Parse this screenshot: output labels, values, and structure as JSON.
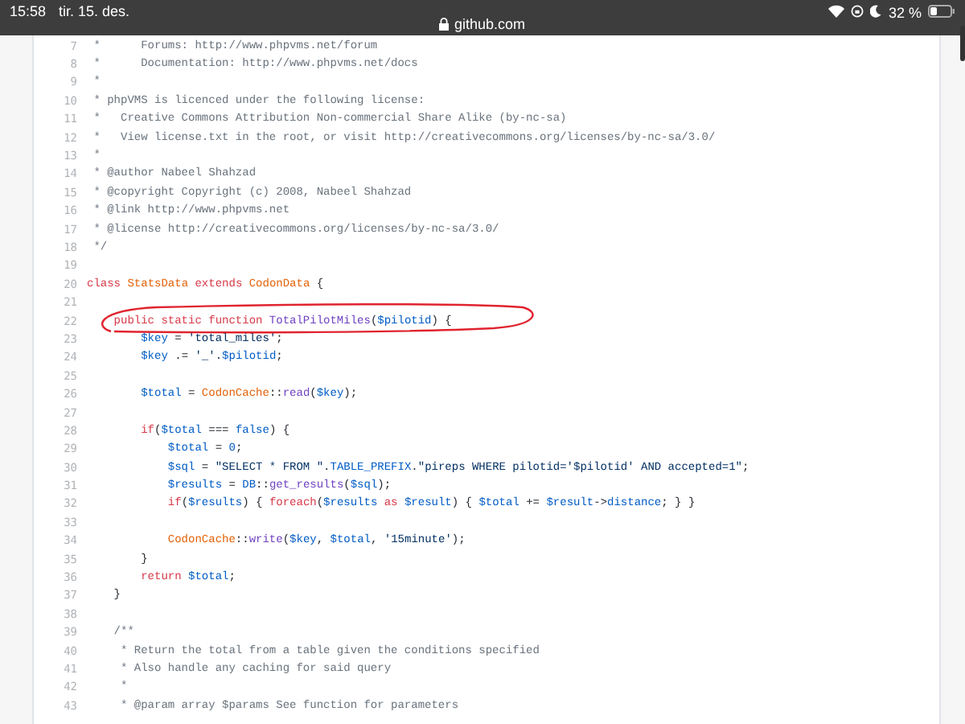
{
  "status_bar": {
    "time": "15:58",
    "date": "tir. 15. des.",
    "battery_percent": "32 %"
  },
  "address_bar": {
    "url": "github.com"
  },
  "code_lines": [
    {
      "number": "7",
      "tokens": [
        {
          "kind": "comment",
          "text": " *      Forums: http://www.phpvms.net/forum"
        }
      ]
    },
    {
      "number": "8",
      "tokens": [
        {
          "kind": "comment",
          "text": " *      Documentation: http://www.phpvms.net/docs"
        }
      ]
    },
    {
      "number": "9",
      "tokens": [
        {
          "kind": "comment",
          "text": " *"
        }
      ]
    },
    {
      "number": "10",
      "tokens": [
        {
          "kind": "comment",
          "text": " * phpVMS is licenced under the following license:"
        }
      ]
    },
    {
      "number": "11",
      "tokens": [
        {
          "kind": "comment",
          "text": " *   Creative Commons Attribution Non-commercial Share Alike (by-nc-sa)"
        }
      ]
    },
    {
      "number": "12",
      "tokens": [
        {
          "kind": "comment",
          "text": " *   View license.txt in the root, or visit http://creativecommons.org/licenses/by-nc-sa/3.0/"
        }
      ]
    },
    {
      "number": "13",
      "tokens": [
        {
          "kind": "comment",
          "text": " *"
        }
      ]
    },
    {
      "number": "14",
      "tokens": [
        {
          "kind": "comment",
          "text": " * @author Nabeel Shahzad"
        }
      ]
    },
    {
      "number": "15",
      "tokens": [
        {
          "kind": "comment",
          "text": " * @copyright Copyright (c) 2008, Nabeel Shahzad"
        }
      ]
    },
    {
      "number": "16",
      "tokens": [
        {
          "kind": "comment",
          "text": " * @link http://www.phpvms.net"
        }
      ]
    },
    {
      "number": "17",
      "tokens": [
        {
          "kind": "comment",
          "text": " * @license http://creativecommons.org/licenses/by-nc-sa/3.0/"
        }
      ]
    },
    {
      "number": "18",
      "tokens": [
        {
          "kind": "comment",
          "text": " */"
        }
      ]
    },
    {
      "number": "19"
    },
    {
      "number": "20",
      "tokens": [
        {
          "kind": "keyword",
          "text": "class "
        },
        {
          "kind": "type",
          "text": "StatsData "
        },
        {
          "kind": "keyword",
          "text": "extends "
        },
        {
          "kind": "type",
          "text": "CodonData"
        },
        {
          "kind": "plain",
          "text": " {"
        }
      ]
    },
    {
      "number": "21"
    },
    {
      "number": "22",
      "tokens": [
        {
          "kind": "keyword",
          "text": "    public static function "
        },
        {
          "kind": "function",
          "text": "TotalPilotMiles"
        },
        {
          "kind": "plain",
          "text": "("
        },
        {
          "kind": "variable",
          "text": "$pilotid"
        },
        {
          "kind": "plain",
          "text": ") {"
        }
      ]
    },
    {
      "number": "23",
      "tokens": [
        {
          "kind": "variable",
          "text": "        $key"
        },
        {
          "kind": "plain",
          "text": " = "
        },
        {
          "kind": "string",
          "text": "'total_miles'"
        },
        {
          "kind": "plain",
          "text": ";"
        }
      ]
    },
    {
      "number": "24",
      "tokens": [
        {
          "kind": "variable",
          "text": "        $key"
        },
        {
          "kind": "plain",
          "text": " .= "
        },
        {
          "kind": "string",
          "text": "'_'"
        },
        {
          "kind": "plain",
          "text": "."
        },
        {
          "kind": "variable",
          "text": "$pilotid"
        },
        {
          "kind": "plain",
          "text": ";"
        }
      ]
    },
    {
      "number": "25"
    },
    {
      "number": "26",
      "tokens": [
        {
          "kind": "variable",
          "text": "        $total"
        },
        {
          "kind": "plain",
          "text": " = "
        },
        {
          "kind": "type",
          "text": "CodonCache"
        },
        {
          "kind": "plain",
          "text": "::"
        },
        {
          "kind": "function",
          "text": "read"
        },
        {
          "kind": "plain",
          "text": "("
        },
        {
          "kind": "variable",
          "text": "$key"
        },
        {
          "kind": "plain",
          "text": ");"
        }
      ]
    },
    {
      "number": "27"
    },
    {
      "number": "28",
      "tokens": [
        {
          "kind": "keyword",
          "text": "        if"
        },
        {
          "kind": "plain",
          "text": "("
        },
        {
          "kind": "variable",
          "text": "$total"
        },
        {
          "kind": "plain",
          "text": " === "
        },
        {
          "kind": "constant",
          "text": "false"
        },
        {
          "kind": "plain",
          "text": ") {"
        }
      ]
    },
    {
      "number": "29",
      "tokens": [
        {
          "kind": "variable",
          "text": "            $total"
        },
        {
          "kind": "plain",
          "text": " = "
        },
        {
          "kind": "constant",
          "text": "0"
        },
        {
          "kind": "plain",
          "text": ";"
        }
      ]
    },
    {
      "number": "30",
      "tokens": [
        {
          "kind": "variable",
          "text": "            $sql"
        },
        {
          "kind": "plain",
          "text": " = "
        },
        {
          "kind": "string",
          "text": "\"SELECT * FROM \""
        },
        {
          "kind": "plain",
          "text": "."
        },
        {
          "kind": "constant",
          "text": "TABLE_PREFIX"
        },
        {
          "kind": "plain",
          "text": "."
        },
        {
          "kind": "string",
          "text": "\"pireps WHERE pilotid='$pilotid' AND accepted=1\""
        },
        {
          "kind": "plain",
          "text": ";"
        }
      ]
    },
    {
      "number": "31",
      "tokens": [
        {
          "kind": "variable",
          "text": "            $results"
        },
        {
          "kind": "plain",
          "text": " = "
        },
        {
          "kind": "constant",
          "text": "DB"
        },
        {
          "kind": "plain",
          "text": "::"
        },
        {
          "kind": "function",
          "text": "get_results"
        },
        {
          "kind": "plain",
          "text": "("
        },
        {
          "kind": "variable",
          "text": "$sql"
        },
        {
          "kind": "plain",
          "text": ");"
        }
      ]
    },
    {
      "number": "32",
      "tokens": [
        {
          "kind": "keyword",
          "text": "            if"
        },
        {
          "kind": "plain",
          "text": "("
        },
        {
          "kind": "variable",
          "text": "$results"
        },
        {
          "kind": "plain",
          "text": ") { "
        },
        {
          "kind": "keyword",
          "text": "foreach"
        },
        {
          "kind": "plain",
          "text": "("
        },
        {
          "kind": "variable",
          "text": "$results "
        },
        {
          "kind": "keyword",
          "text": "as "
        },
        {
          "kind": "variable",
          "text": "$result"
        },
        {
          "kind": "plain",
          "text": ") { "
        },
        {
          "kind": "variable",
          "text": "$total"
        },
        {
          "kind": "plain",
          "text": " += "
        },
        {
          "kind": "variable",
          "text": "$result"
        },
        {
          "kind": "plain",
          "text": "->"
        },
        {
          "kind": "constant",
          "text": "distance"
        },
        {
          "kind": "plain",
          "text": "; } }"
        }
      ]
    },
    {
      "number": "33"
    },
    {
      "number": "34",
      "tokens": [
        {
          "kind": "type",
          "text": "            CodonCache"
        },
        {
          "kind": "plain",
          "text": "::"
        },
        {
          "kind": "function",
          "text": "write"
        },
        {
          "kind": "plain",
          "text": "("
        },
        {
          "kind": "variable",
          "text": "$key"
        },
        {
          "kind": "plain",
          "text": ", "
        },
        {
          "kind": "variable",
          "text": "$total"
        },
        {
          "kind": "plain",
          "text": ", "
        },
        {
          "kind": "string",
          "text": "'15minute'"
        },
        {
          "kind": "plain",
          "text": ");"
        }
      ]
    },
    {
      "number": "35",
      "tokens": [
        {
          "kind": "plain",
          "text": "        }"
        }
      ]
    },
    {
      "number": "36",
      "tokens": [
        {
          "kind": "keyword",
          "text": "        return "
        },
        {
          "kind": "variable",
          "text": "$total"
        },
        {
          "kind": "plain",
          "text": ";"
        }
      ]
    },
    {
      "number": "37",
      "tokens": [
        {
          "kind": "plain",
          "text": "    }"
        }
      ]
    },
    {
      "number": "38"
    },
    {
      "number": "39",
      "tokens": [
        {
          "kind": "comment",
          "text": "    /**"
        }
      ]
    },
    {
      "number": "40",
      "tokens": [
        {
          "kind": "comment",
          "text": "     * Return the total from a table given the conditions specified"
        }
      ]
    },
    {
      "number": "41",
      "tokens": [
        {
          "kind": "comment",
          "text": "     * Also handle any caching for said query"
        }
      ]
    },
    {
      "number": "42",
      "tokens": [
        {
          "kind": "comment",
          "text": "     *"
        }
      ]
    },
    {
      "number": "43",
      "tokens": [
        {
          "kind": "comment",
          "text": "     * @param array $params See function for parameters"
        }
      ]
    }
  ]
}
